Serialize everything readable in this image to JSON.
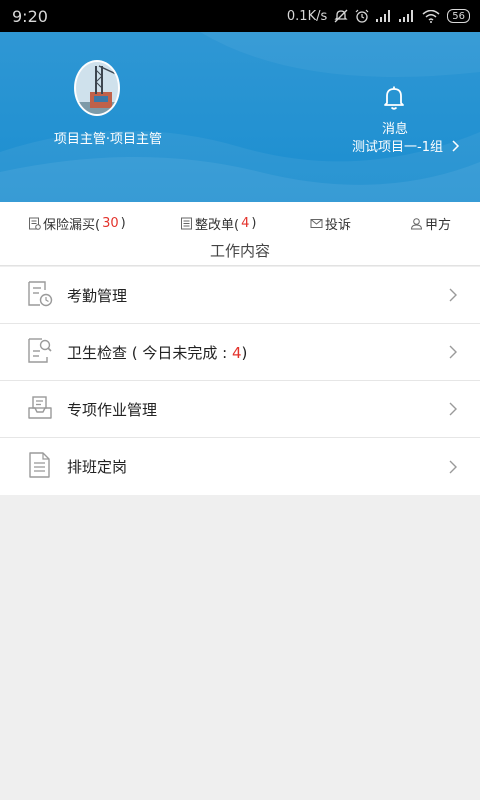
{
  "status_bar": {
    "time": "9:20",
    "speed": "0.1K/s",
    "battery": "56",
    "icons": [
      "silent-icon",
      "alarm-icon",
      "signal-icon",
      "signal-icon",
      "wifi-icon",
      "battery-icon"
    ]
  },
  "header": {
    "user_name": "项目主管·项目主管",
    "message_label": "消息",
    "project_label": "测试项目一-1组",
    "bell_icon": "bell-icon",
    "background_color": "#2393d2"
  },
  "tabs": [
    {
      "icon": "insurance-icon",
      "label": "保险漏买(",
      "count": "30",
      "suffix": ")"
    },
    {
      "icon": "list-icon",
      "label": "整改单(",
      "count": "4",
      "suffix": ")"
    },
    {
      "icon": "mail-icon",
      "label": "投诉",
      "count": "",
      "suffix": ""
    },
    {
      "icon": "person-icon",
      "label": "甲方",
      "count": "",
      "suffix": ""
    }
  ],
  "work_title": "工作内容",
  "list": [
    {
      "icon": "attendance-icon",
      "label": "考勤管理",
      "prefix": "",
      "highlight": "",
      "suffix": ""
    },
    {
      "icon": "inspection-icon",
      "label": "卫生检查 ( 今日未完成 : ",
      "highlight": "4",
      "suffix": ")"
    },
    {
      "icon": "task-icon",
      "label": "专项作业管理",
      "highlight": "",
      "suffix": ""
    },
    {
      "icon": "schedule-icon",
      "label": "排班定岗",
      "highlight": "",
      "suffix": ""
    }
  ],
  "colors": {
    "accent_red": "#e3332c",
    "header_blue": "#2393d2"
  }
}
